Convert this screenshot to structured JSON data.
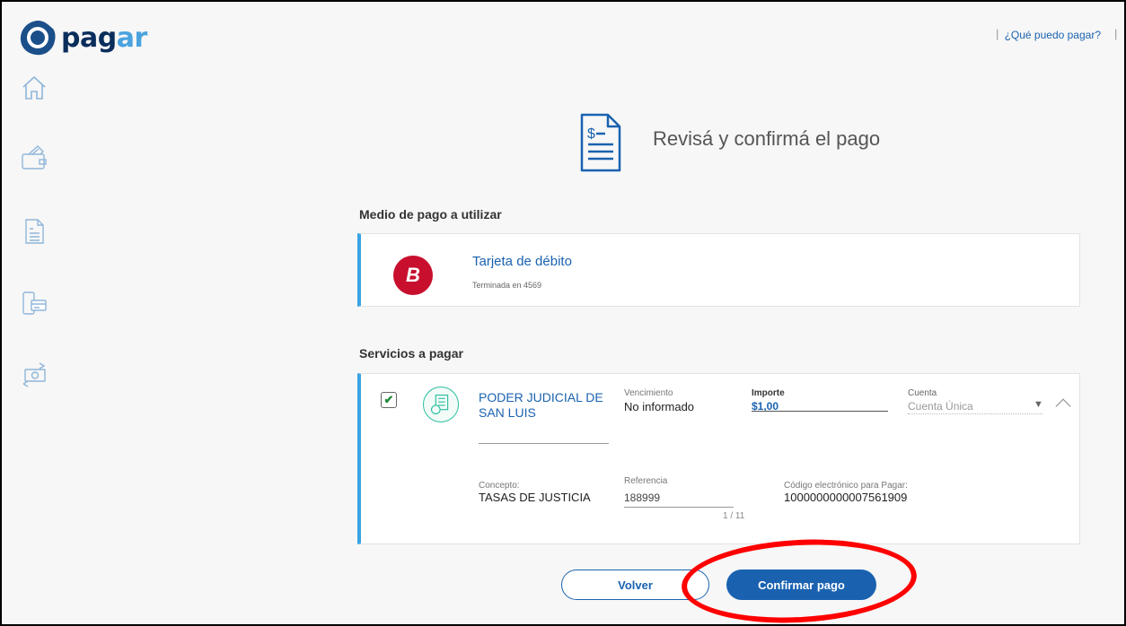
{
  "brand": {
    "name_main": "pag",
    "name_accent": "ar"
  },
  "header": {
    "help_link": "¿Qué puedo pagar?",
    "separator": "|"
  },
  "sidebar": {
    "items": [
      {
        "icon": "home-icon"
      },
      {
        "icon": "wallet-icon"
      },
      {
        "icon": "invoice-icon"
      },
      {
        "icon": "mobile-payment-icon"
      },
      {
        "icon": "money-transfer-icon"
      }
    ]
  },
  "page": {
    "title": "Revisá y confirmá el pago",
    "icon": "invoice-icon"
  },
  "payment_method": {
    "section_label": "Medio de pago a utilizar",
    "logo_text": "B",
    "title": "Tarjeta de débito",
    "subtitle": "Terminada en 4569"
  },
  "services": {
    "section_label": "Servicios a pagar",
    "item": {
      "checked": true,
      "check_glyph": "✔",
      "name": "PODER JUDICIAL DE SAN LUIS",
      "vencimiento_label": "Vencimiento",
      "vencimiento_value": "No informado",
      "importe_label": "Importe",
      "importe_value": "$1,00",
      "cuenta_label": "Cuenta",
      "cuenta_value": "Cuenta Única",
      "concepto_label": "Concepto:",
      "concepto_value": "TASAS DE JUSTICIA",
      "referencia_label": "Referencia",
      "referencia_value": "188999",
      "referencia_counter": "1 / 11",
      "codigo_label": "Código electrónico para Pagar:",
      "codigo_value": "1000000000007561909"
    }
  },
  "buttons": {
    "back": "Volver",
    "confirm": "Confirmar pago"
  },
  "colors": {
    "accent": "#1a62b0",
    "card_border": "#3aa3e3",
    "debit_brand": "#c8102e",
    "annotation": "#ff0000"
  }
}
